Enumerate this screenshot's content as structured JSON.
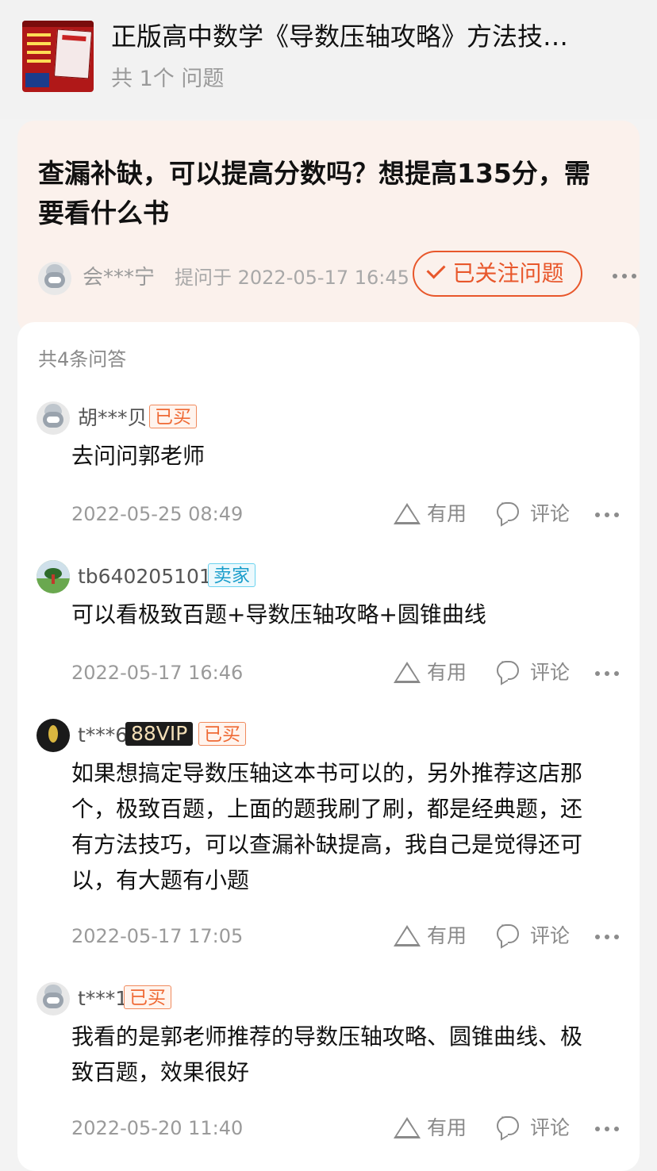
{
  "product": {
    "title": "正版高中数学《导数压轴攻略》方法技…",
    "subtitle": "共 1个 问题"
  },
  "question": {
    "title": "查漏补缺，可以提高分数吗？想提高135分，需要看什么书",
    "asker": "会***宁",
    "asked_at": "提问于 2022-05-17 16:45",
    "follow_label": "已关注问题"
  },
  "answers_count": "共4条问答",
  "answers": [
    {
      "user": "胡***贝",
      "badges": [
        "已买"
      ],
      "text": "去问问郭老师",
      "date": "2022-05-25 08:49"
    },
    {
      "user": "tb640205101",
      "badges": [
        "卖家"
      ],
      "text": "可以看极致百题+导数压轴攻略+圆锥曲线",
      "date": "2022-05-17 16:46"
    },
    {
      "user": "t***6",
      "badges": [
        "88VIP",
        "已买"
      ],
      "text": "如果想搞定导数压轴这本书可以的，另外推荐这店那个，极致百题，上面的题我刷了刷，都是经典题，还有方法技巧，可以查漏补缺提高，我自己是觉得还可以，有大题有小题",
      "date": "2022-05-17 17:05"
    },
    {
      "user": "t***1",
      "badges": [
        "已买"
      ],
      "text": "我看的是郭老师推荐的导数压轴攻略、圆锥曲线、极致百题，效果很好",
      "date": "2022-05-20 11:40"
    }
  ],
  "actions": {
    "useful_label": "有用",
    "comment_label": "评论"
  },
  "colors": {
    "accent": "#e8572b",
    "bought_badge": "#ef6a35",
    "seller_badge": "#1a9dca",
    "vip_badge_bg": "#1c1c1c",
    "question_card_bg": "#fbf1ec"
  }
}
